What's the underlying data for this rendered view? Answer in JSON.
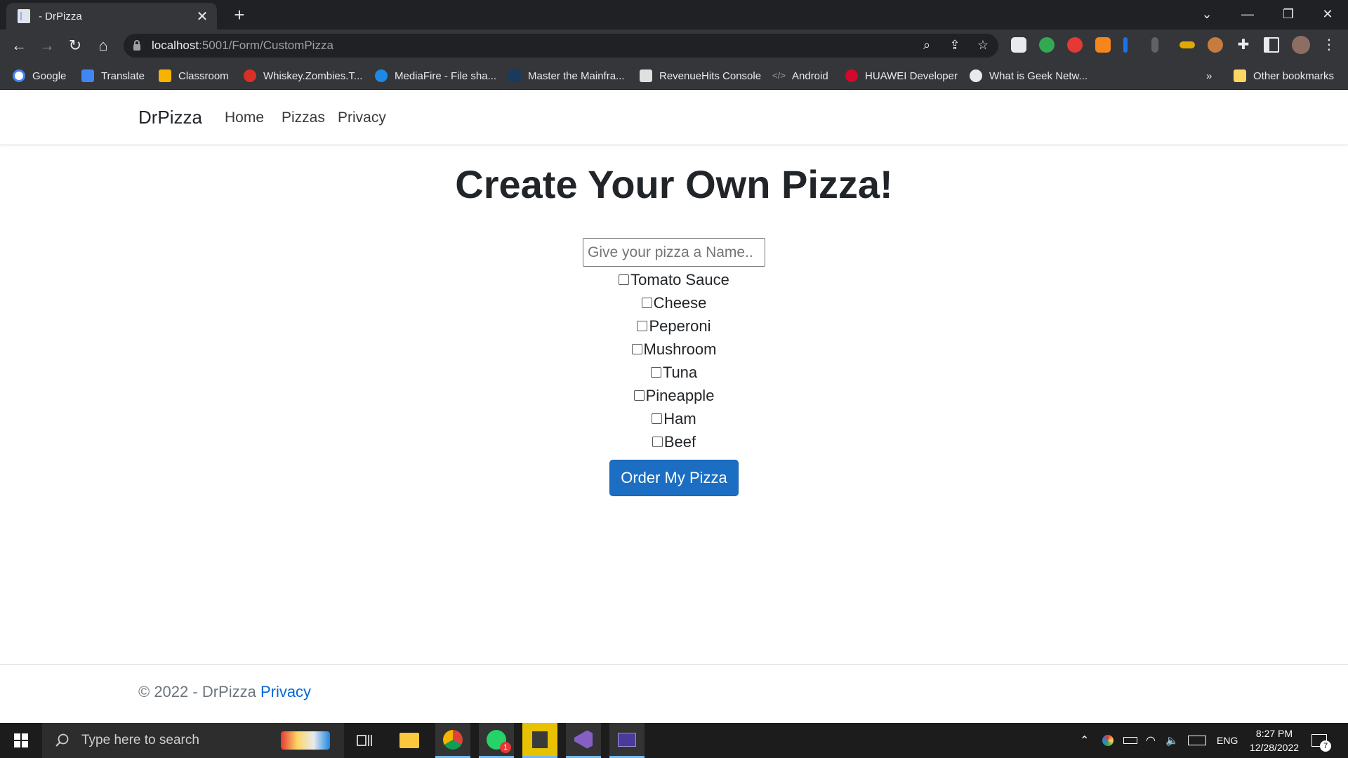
{
  "browser": {
    "tab_title": "- DrPizza",
    "tab_close": "✕",
    "new_tab": "+",
    "window_controls": {
      "dropdown": "⌄",
      "minimize": "—",
      "restore": "❐",
      "close": "✕"
    },
    "nav": {
      "back": "←",
      "forward": "→",
      "reload": "↻",
      "home": "⌂"
    },
    "url_host": "localhost",
    "url_path": ":5001/Form/CustomPizza",
    "bookmarks": [
      {
        "label": "Google",
        "color": "#4285f4"
      },
      {
        "label": "Translate",
        "color": "#4285f4"
      },
      {
        "label": "Classroom",
        "color": "#f4b400"
      },
      {
        "label": "Whiskey.Zombies.T...",
        "color": "#d93025"
      },
      {
        "label": "MediaFire - File sha...",
        "color": "#1e88e5"
      },
      {
        "label": "Master the Mainfra...",
        "color": "#1a3a5c"
      },
      {
        "label": "RevenueHits Console",
        "color": "#e0e0e0"
      },
      {
        "label": "Android",
        "color": "#9aa0a6"
      },
      {
        "label": "HUAWEI Developer",
        "color": "#cf0a2c"
      },
      {
        "label": "What is Geek Netw...",
        "color": "#e8eaed"
      }
    ],
    "bookmarks_overflow": "»",
    "other_bookmarks": "Other bookmarks"
  },
  "site": {
    "brand": "DrPizza",
    "nav_links": [
      "Home",
      "Pizzas",
      "Privacy"
    ]
  },
  "form": {
    "title": "Create Your Own Pizza!",
    "name_placeholder": "Give your pizza a Name..",
    "toppings": [
      "Tomato Sauce",
      "Cheese",
      "Peperoni",
      "Mushroom",
      "Tuna",
      "Pineapple",
      "Ham",
      "Beef"
    ],
    "submit_label": "Order My Pizza"
  },
  "footer": {
    "copyright": "© 2022 - DrPizza ",
    "privacy_link": "Privacy"
  },
  "taskbar": {
    "search_placeholder": "Type here to search",
    "language": "ENG",
    "time": "8:27 PM",
    "date": "12/28/2022",
    "whatsapp_badge": "1",
    "notification_count": "7"
  },
  "colors": {
    "primary_button": "#1b6ec2",
    "link": "#0366d6",
    "browser_dark": "#202124",
    "browser_toolbar": "#35363a"
  }
}
